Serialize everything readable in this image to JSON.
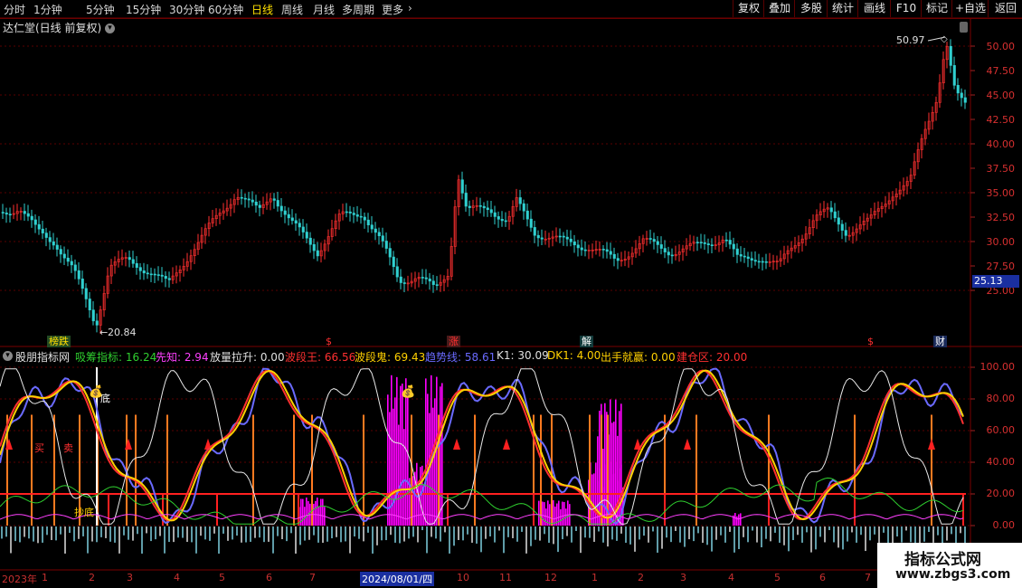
{
  "toolbar": {
    "periods": [
      "分时",
      "1分钟",
      "5分钟",
      "15分钟",
      "30分钟",
      "60分钟",
      "日线",
      "周线",
      "月线",
      "多周期",
      "更多"
    ],
    "active_period": "日线",
    "buttons": [
      "复权",
      "叠加",
      "多股",
      "统计",
      "画线",
      "F10",
      "标记",
      "+自选",
      "返回"
    ]
  },
  "main_chart": {
    "title": "达仁堂(日线 前复权)",
    "high_label": "50.97",
    "low_label": "20.84",
    "current_price": "25.13",
    "y_ticks": [
      "50.00",
      "47.50",
      "45.00",
      "42.50",
      "40.00",
      "37.50",
      "35.00",
      "32.50",
      "30.00",
      "27.50",
      "25.00"
    ],
    "events": [
      {
        "label": "榜跌",
        "color": "#2fbf3a"
      },
      {
        "label": "$",
        "color": "#ff3030"
      },
      {
        "label": "涨",
        "color": "#ff3030"
      },
      {
        "label": "解",
        "color": "#33cccc"
      },
      {
        "label": "$",
        "color": "#ff3030"
      },
      {
        "label": "财",
        "color": "#3f7fff"
      }
    ]
  },
  "indicator": {
    "name": "股朋指标网",
    "items": [
      {
        "label": "吸筹指标: 16.24",
        "color": "#2fcf2f"
      },
      {
        "label": "先知: 2.94",
        "color": "#ff40ff"
      },
      {
        "label": "放量拉升: 0.00",
        "color": "#e0e0e0"
      },
      {
        "label": "波段王: 66.56",
        "color": "#ff3030"
      },
      {
        "label": "波段鬼: 69.43",
        "color": "#ffd000"
      },
      {
        "label": "趋势线: 58.61",
        "color": "#6a6aff"
      },
      {
        "label": "K1: 30.09",
        "color": "#e0e0e0"
      },
      {
        "label": "DK1: 4.00",
        "color": "#ffd000"
      },
      {
        "label": "出手就赢: 0.00",
        "color": "#ffd000"
      },
      {
        "label": "建仓区: 20.00",
        "color": "#ff3030"
      }
    ],
    "y_ticks": [
      "100.00",
      "80.00",
      "60.00",
      "40.00",
      "20.00",
      "0.00"
    ],
    "marker_texts": [
      "底",
      "买",
      "卖",
      "抄底"
    ]
  },
  "x_axis": {
    "labels": [
      "2023年",
      "1",
      "2",
      "3",
      "4",
      "5",
      "6",
      "7",
      "2024/08/01/四",
      "10",
      "11",
      "12",
      "1",
      "2",
      "3",
      "4",
      "5",
      "6",
      "7"
    ]
  },
  "watermark": {
    "line1": "指标公式网",
    "line2": "www.zbgs3.com"
  },
  "colors": {
    "up": "#ff3030",
    "down": "#30d0d0",
    "ema": "#ff3030",
    "trend": "#6a6aff",
    "yellow": "#ffd000",
    "magenta": "#ff00ff"
  }
}
